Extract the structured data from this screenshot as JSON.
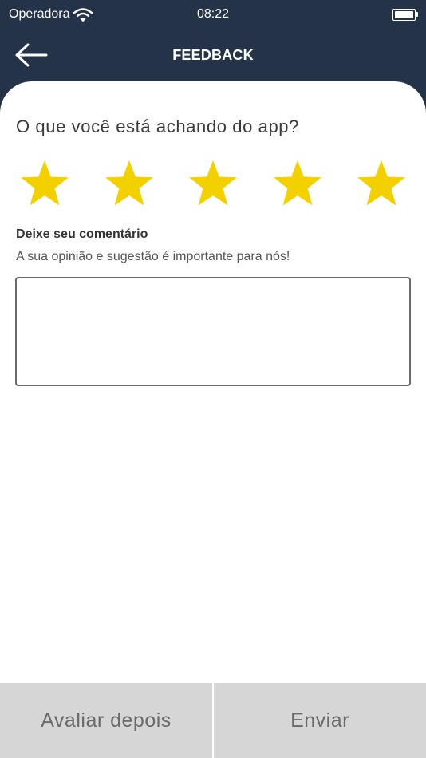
{
  "status_bar": {
    "carrier": "Operadora",
    "time": "08:22",
    "wifi_icon": "wifi-icon",
    "battery_icon": "battery-icon"
  },
  "nav": {
    "title": "FEEDBACK",
    "back_icon": "arrow-left-icon"
  },
  "colors": {
    "header_bg": "#243348",
    "star": "#f3d100",
    "bottom_bar": "#d6d6d6"
  },
  "rating": {
    "question": "O que você está achando do app?",
    "max": 5,
    "value": 5,
    "star_icon": "star-icon"
  },
  "comment": {
    "label": "Deixe seu comentário",
    "hint": "A sua opinião e sugestão é importante para nós!",
    "value": "",
    "placeholder": ""
  },
  "actions": {
    "later_label": "Avaliar depois",
    "send_label": "Enviar"
  }
}
